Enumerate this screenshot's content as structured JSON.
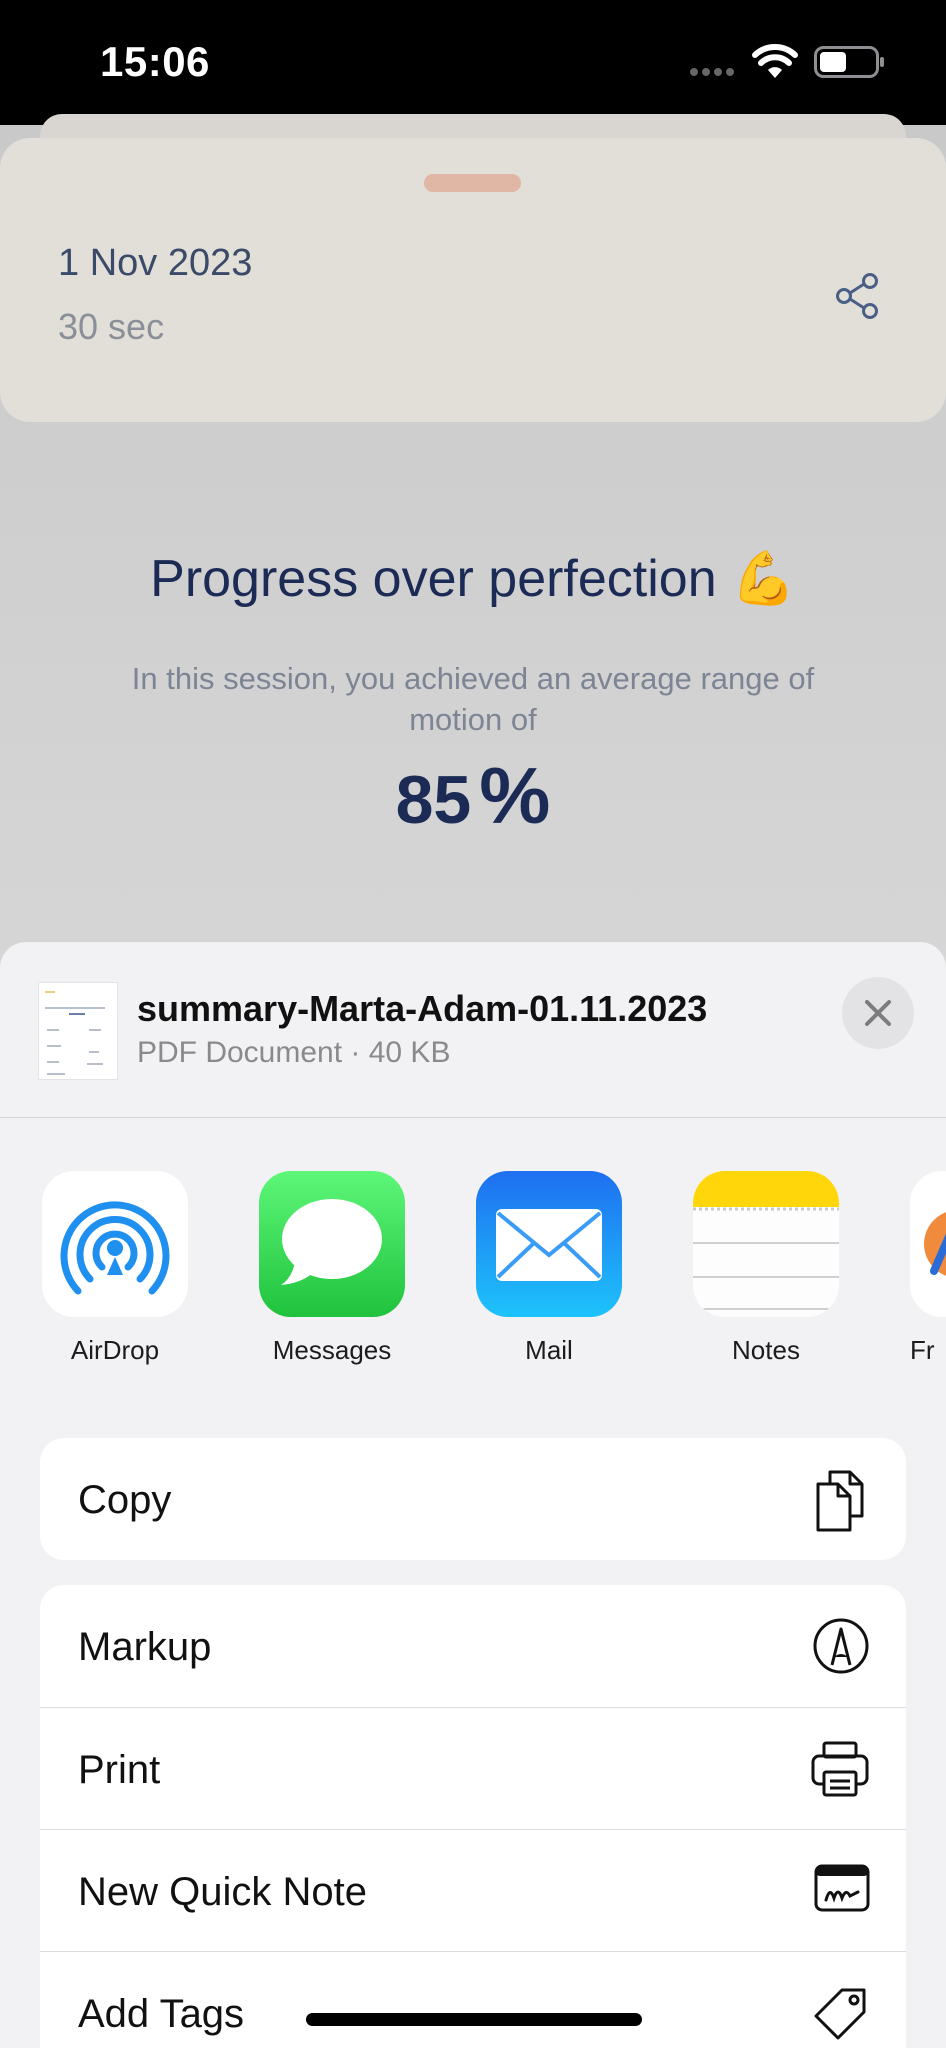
{
  "status_bar": {
    "time": "15:06"
  },
  "summary_card": {
    "date": "1 Nov 2023",
    "duration": "30 sec"
  },
  "summary": {
    "headline": "Progress over perfection",
    "headline_emoji": "💪",
    "description": "In this session, you achieved an average range of motion of",
    "value": "85",
    "unit": "%"
  },
  "share_sheet": {
    "document": {
      "title": "summary-Marta-Adam-01.11.2023",
      "meta": "PDF Document · 40 KB"
    },
    "apps": [
      {
        "label": "AirDrop",
        "icon": "airdrop-icon"
      },
      {
        "label": "Messages",
        "icon": "messages-icon"
      },
      {
        "label": "Mail",
        "icon": "mail-icon"
      },
      {
        "label": "Notes",
        "icon": "notes-icon"
      },
      {
        "label": "Fr",
        "icon": "freeform-icon"
      }
    ],
    "actions_group_1": [
      {
        "label": "Copy",
        "icon": "copy-icon"
      }
    ],
    "actions_group_2": [
      {
        "label": "Markup",
        "icon": "markup-icon"
      },
      {
        "label": "Print",
        "icon": "print-icon"
      },
      {
        "label": "New Quick Note",
        "icon": "quick-note-icon"
      },
      {
        "label": "Add Tags",
        "icon": "tag-icon"
      }
    ]
  },
  "colors": {
    "brand_navy": "#1b2b55",
    "card_beige": "#e2dfd9",
    "grabber_peach": "#e0b6a5",
    "messages_green": "#34c759",
    "mail_blue": "#1a82f7",
    "notes_yellow": "#ffd60a"
  }
}
